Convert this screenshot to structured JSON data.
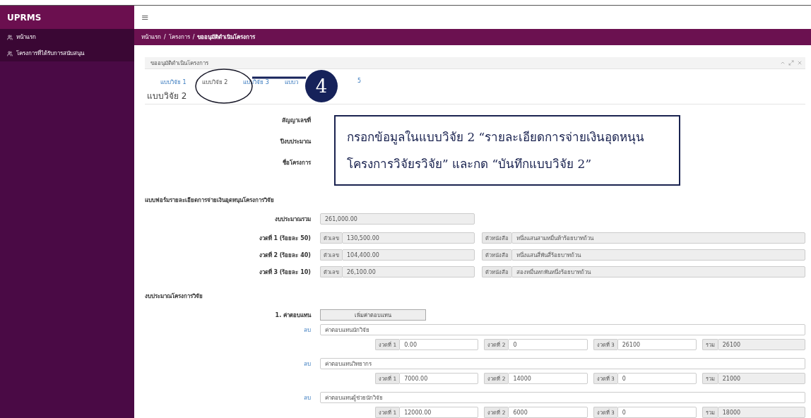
{
  "sidebar": {
    "brand": "UPRMS",
    "items": [
      {
        "label": "หน้าแรก",
        "selected": false
      },
      {
        "label": "โครงการที่ได้รับการสนับสนุน",
        "selected": false
      }
    ]
  },
  "topbar": {
    "menu_icon": "≡"
  },
  "breadcrumb": {
    "separator": "/",
    "items": [
      "หน้าแรก",
      "โครงการ",
      "ขออนุมัติดำเนินโครงการ"
    ]
  },
  "panel": {
    "title": "ขออนุมัติดำเนินโครงการ"
  },
  "tabs": [
    {
      "label": "แบบวิจัย 1",
      "selected": false
    },
    {
      "label": "แบบวิจัย 2",
      "selected": true
    },
    {
      "label": "แบบวิจัย 3",
      "selected": false
    },
    {
      "label": "แบบว",
      "selected": false
    },
    {
      "label": "5",
      "selected": false
    }
  ],
  "form_title": "แบบวิจัย 2",
  "info_labels": [
    "สัญญาเลขที่",
    "ปีงบประมาณ",
    "ชื่อโครงการ"
  ],
  "section_title": "แบบฟอร์มรายละเอียดการจ่ายเงินอุดหนุนโครงการวิจัย",
  "total": {
    "label": "งบประมาณรวม",
    "value": "261,000.00"
  },
  "installments": [
    {
      "label": "งวดที่ 1 (ร้อยละ 50)",
      "number_addon": "ตัวเลข",
      "number": "130,500.00",
      "text_addon": "ตัวหนังสือ",
      "text": "หนึ่งแสนสามหมื่นห้าร้อยบาทถ้วน"
    },
    {
      "label": "งวดที่ 2 (ร้อยละ 40)",
      "number_addon": "ตัวเลข",
      "number": "104,400.00",
      "text_addon": "ตัวหนังสือ",
      "text": "หนึ่งแสนสี่พันสี่ร้อยบาทถ้วน"
    },
    {
      "label": "งวดที่ 3 (ร้อยละ 10)",
      "number_addon": "ตัวเลข",
      "number": "26,100.00",
      "text_addon": "ตัวหนังสือ",
      "text": "สองหมื่นหกพันหนึ่งร้อยบาทถ้วน"
    }
  ],
  "budget_title": "งบประมาณโครงการวิจัย",
  "category": {
    "label": "1. ค่าตอบแทน",
    "button": "เพิ่มค่าตอบแทน"
  },
  "items": [
    {
      "delete": "ลบ",
      "name": "ค่าตอบแทนนักวิจัย",
      "amounts": [
        {
          "addon": "งวดที่ 1",
          "value": "0.00"
        },
        {
          "addon": "งวดที่ 2",
          "value": "0"
        },
        {
          "addon": "งวดที่ 3",
          "value": "26100"
        }
      ],
      "total_addon": "รวม",
      "total": "26100"
    },
    {
      "delete": "ลบ",
      "name": "ค่าตอบแทนวิทยากร",
      "amounts": [
        {
          "addon": "งวดที่ 1",
          "value": "7000.00"
        },
        {
          "addon": "งวดที่ 2",
          "value": "14000"
        },
        {
          "addon": "งวดที่ 3",
          "value": "0"
        }
      ],
      "total_addon": "รวม",
      "total": "21000"
    },
    {
      "delete": "ลบ",
      "name": "ค่าตอบแทนผู้ช่วยนักวิจัย",
      "amounts": [
        {
          "addon": "งวดที่ 1",
          "value": "12000.00"
        },
        {
          "addon": "งวดที่ 2",
          "value": "6000"
        },
        {
          "addon": "งวดที่ 3",
          "value": "0"
        }
      ],
      "total_addon": "รวม",
      "total": "18000"
    }
  ],
  "annotation": {
    "step": "4",
    "lines": [
      "กรอกข้อมูลในแบบวิจัย 2 “รายละเอียดการจ่ายเงินอุดหนุน",
      "โครงการวิจัยรวิจัย” และกด “บันทึกแบบวิจัย 2”"
    ]
  }
}
